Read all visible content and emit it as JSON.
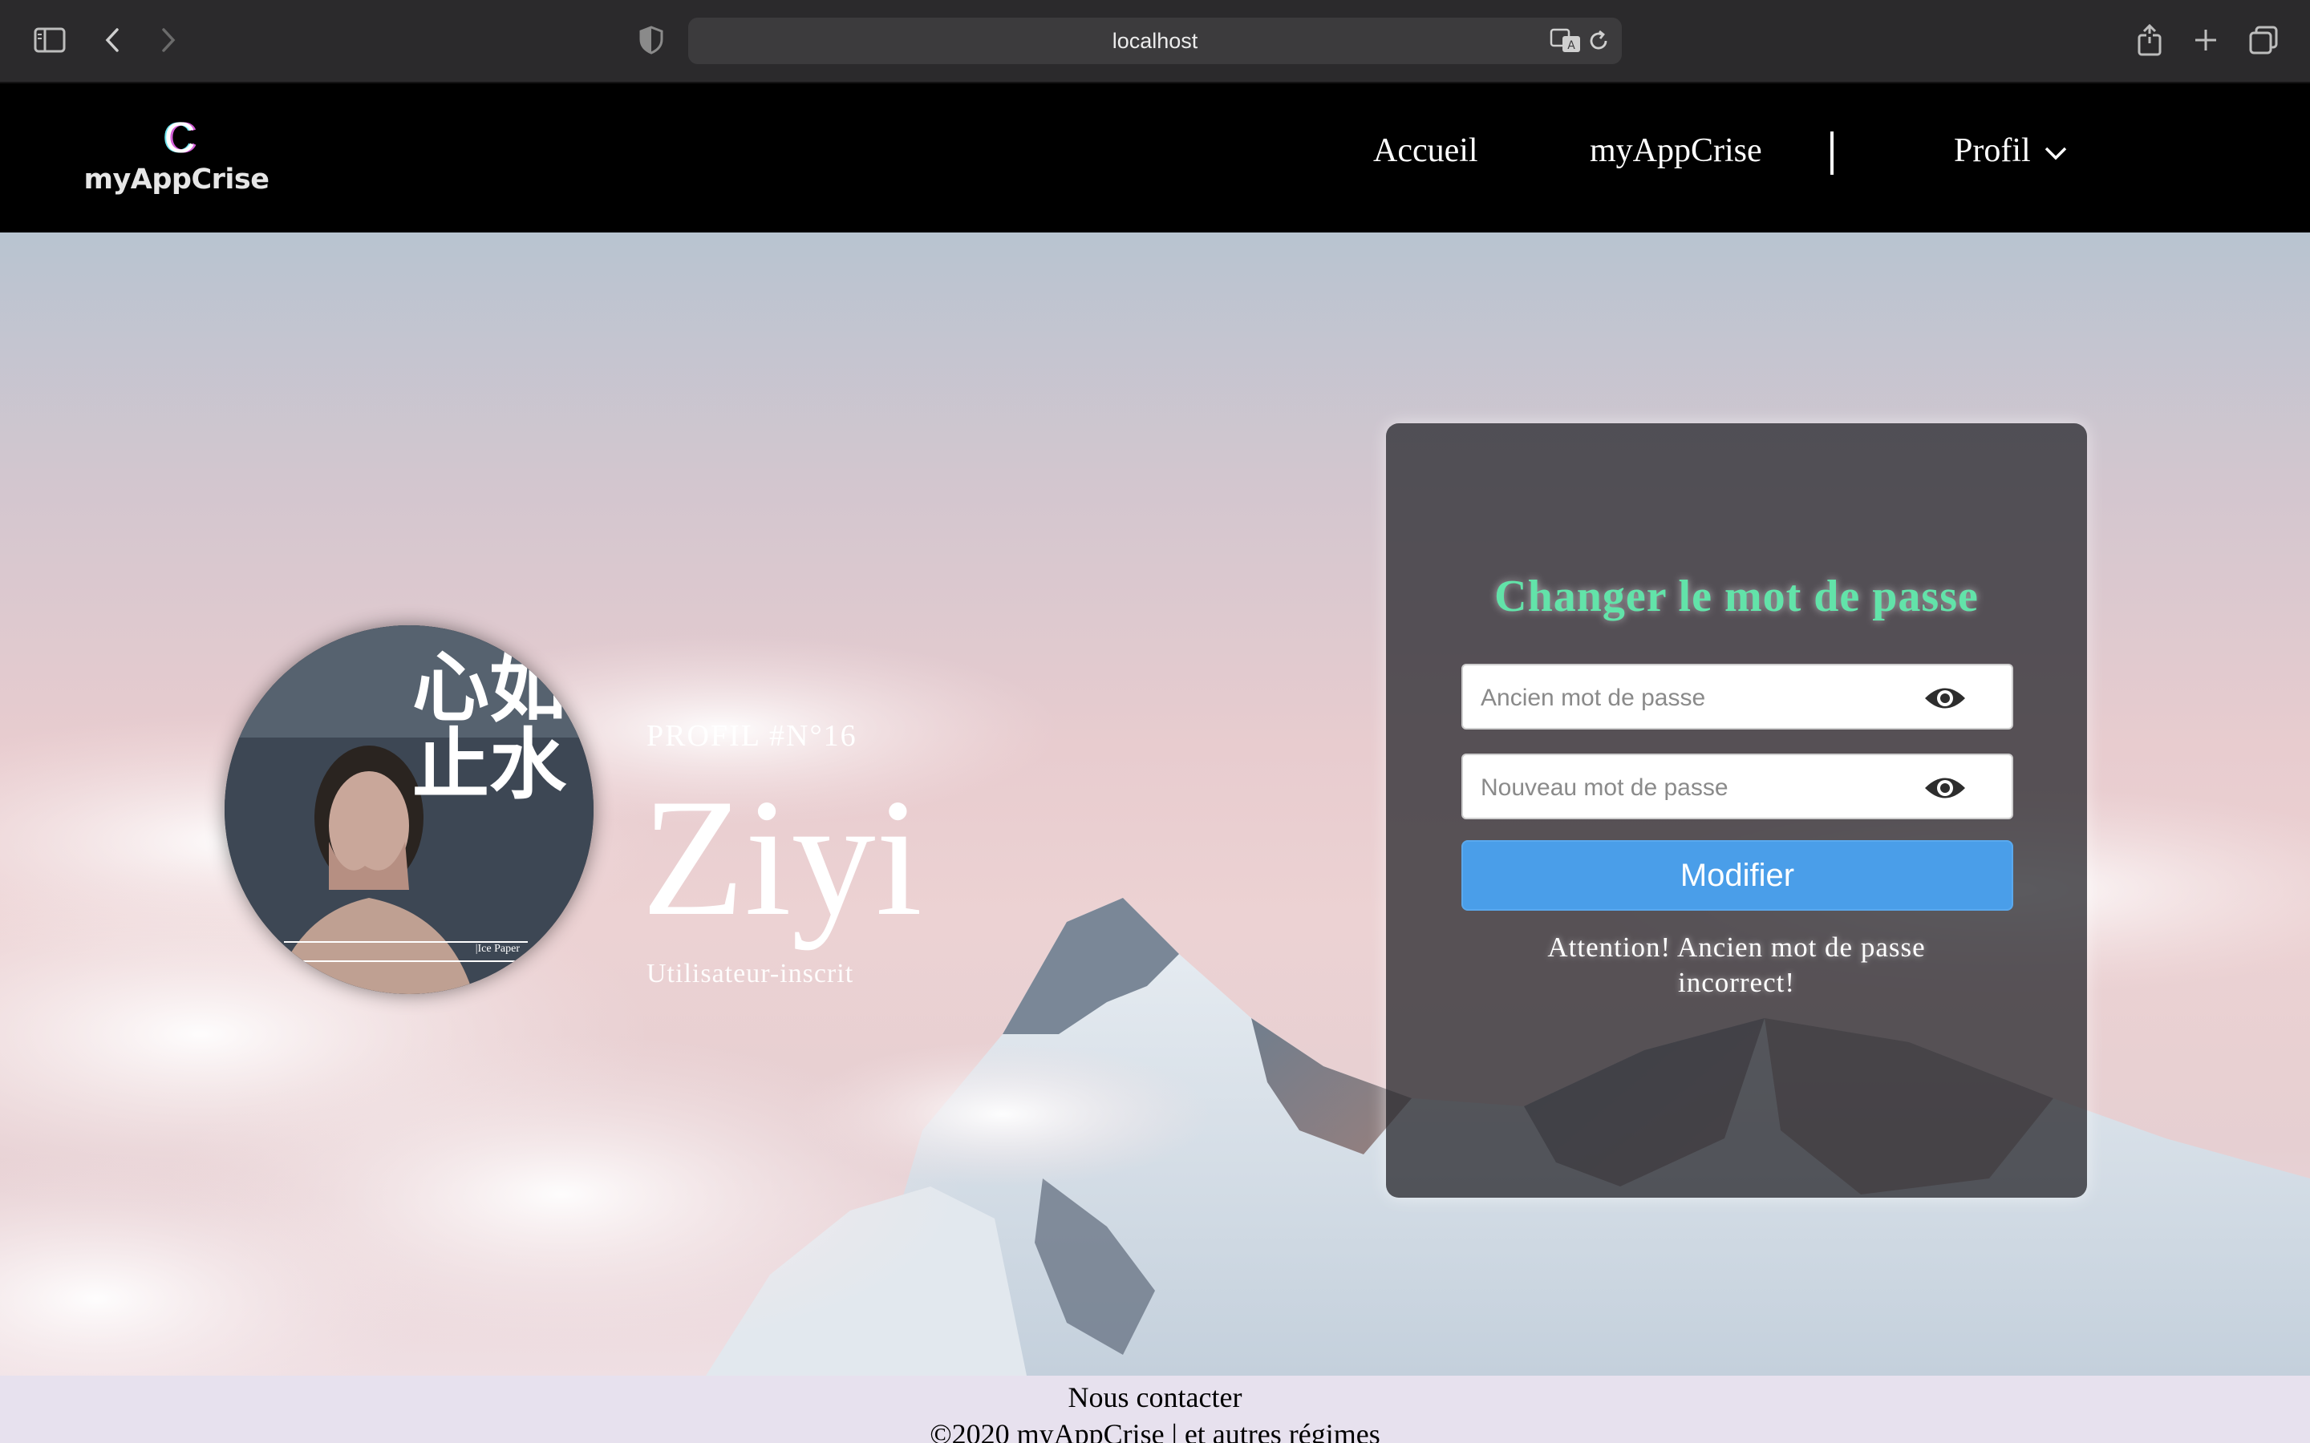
{
  "browser": {
    "url": "localhost"
  },
  "nav": {
    "logo_mark": "C",
    "logo_text": "myAppCrise",
    "links": [
      {
        "label": "Accueil"
      },
      {
        "label": "myAppCrise"
      },
      {
        "label": "Profil"
      }
    ]
  },
  "profile": {
    "number": "PROFIL #N°16",
    "name": "Ziyi",
    "role": "Utilisateur-inscrit",
    "avatar_text": "心如止水",
    "avatar_caption": "|Ice Paper"
  },
  "password_form": {
    "title": "Changer le mot de passe",
    "old_placeholder": "Ancien mot de passe",
    "new_placeholder": "Nouveau mot de passe",
    "submit_label": "Modifier",
    "warning": "Attention! Ancien mot de passe incorrect!"
  },
  "footer": {
    "contact": "Nous contacter",
    "copyright": "©2020 myAppCrise | et autres régimes"
  },
  "colors": {
    "title_accent": "#62e3a9",
    "button": "#4a9ee9",
    "nav_bg": "#000000",
    "footer_bg": "#e7e1ee"
  }
}
